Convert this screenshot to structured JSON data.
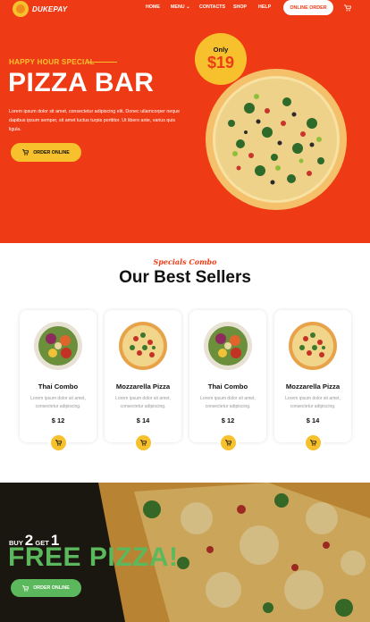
{
  "brand": {
    "name": "DUKEPAY",
    "accent": "#ee3b16",
    "yellow": "#f7c12d",
    "green": "#5cb85c"
  },
  "nav": {
    "items": [
      "HOME",
      "MENU ⌄",
      "CONTACTS",
      "SHOP",
      "HELP"
    ],
    "cta": "ONLINE ORDER",
    "cart_icon": "cart-icon"
  },
  "hero": {
    "kicker": "HAPPY HOUR SPECIAL",
    "title": "PIZZA BAR",
    "text": "Lorem ipsum dolor sit amet, consectetur adipiscing elit. Donec ullamcorper neque dapibus ipsum semper, sit amet luctus turpis porttitor. Ut libero ante, varius quis ligula.",
    "button": "ORDER ONLINE",
    "price_label": "Only",
    "price": "$19"
  },
  "best_sellers": {
    "kicker": "Specials Combo",
    "title": "Our Best Sellers",
    "items": [
      {
        "name": "Thai Combo",
        "desc": "Lorem ipsum dolor sit amet, consectetur adipiscing.",
        "price": "$ 12",
        "kind": "salad"
      },
      {
        "name": "Mozzarella Pizza",
        "desc": "Lorem ipsum dolor sit amet, consectetur adipiscing.",
        "price": "$ 14",
        "kind": "pizza"
      },
      {
        "name": "Thai Combo",
        "desc": "Lorem ipsum dolor sit amet, consectetur adipiscing.",
        "price": "$ 12",
        "kind": "salad"
      },
      {
        "name": "Mozzarella Pizza",
        "desc": "Lorem ipsum dolor sit amet, consectetur adipiscing.",
        "price": "$ 14",
        "kind": "pizza"
      }
    ]
  },
  "promo": {
    "buy_label": "BUY",
    "buy_count": "2",
    "get_label": "GET",
    "get_count": "1",
    "title": "FREE PIZZA!",
    "button": "ORDER ONLINE"
  }
}
